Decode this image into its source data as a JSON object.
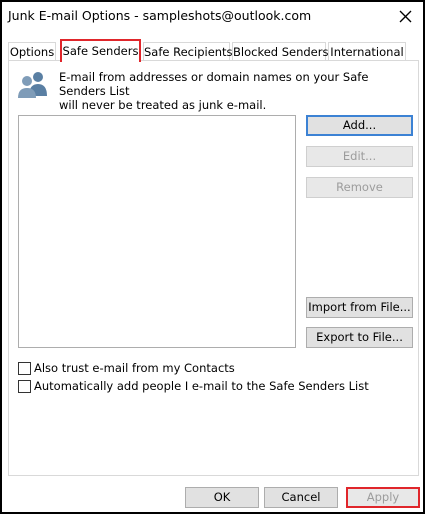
{
  "window": {
    "title": "Junk E-mail Options - sampleshots@outlook.com",
    "close_icon": "close-icon"
  },
  "tabs": [
    {
      "label": "Options",
      "active": false
    },
    {
      "label": "Safe Senders",
      "active": true
    },
    {
      "label": "Safe Recipients",
      "active": false
    },
    {
      "label": "Blocked Senders",
      "active": false
    },
    {
      "label": "International",
      "active": false
    }
  ],
  "safe_senders": {
    "icon": "people-icon",
    "description_line1": "E-mail from addresses or domain names on your Safe Senders List",
    "description_line2": "will never be treated as junk e-mail.",
    "list_items": [],
    "buttons": {
      "add": "Add...",
      "edit": "Edit...",
      "remove": "Remove",
      "import": "Import from File...",
      "export": "Export to File..."
    },
    "options": [
      {
        "label": "Also trust e-mail from my Contacts",
        "checked": false
      },
      {
        "label": "Automatically add people I e-mail to the Safe Senders List",
        "checked": false
      }
    ]
  },
  "footer": {
    "ok": "OK",
    "cancel": "Cancel",
    "apply": "Apply"
  },
  "colors": {
    "highlight": "#e0262b",
    "default_button_border": "#3c82d4",
    "button_face": "#e1e1e1"
  }
}
